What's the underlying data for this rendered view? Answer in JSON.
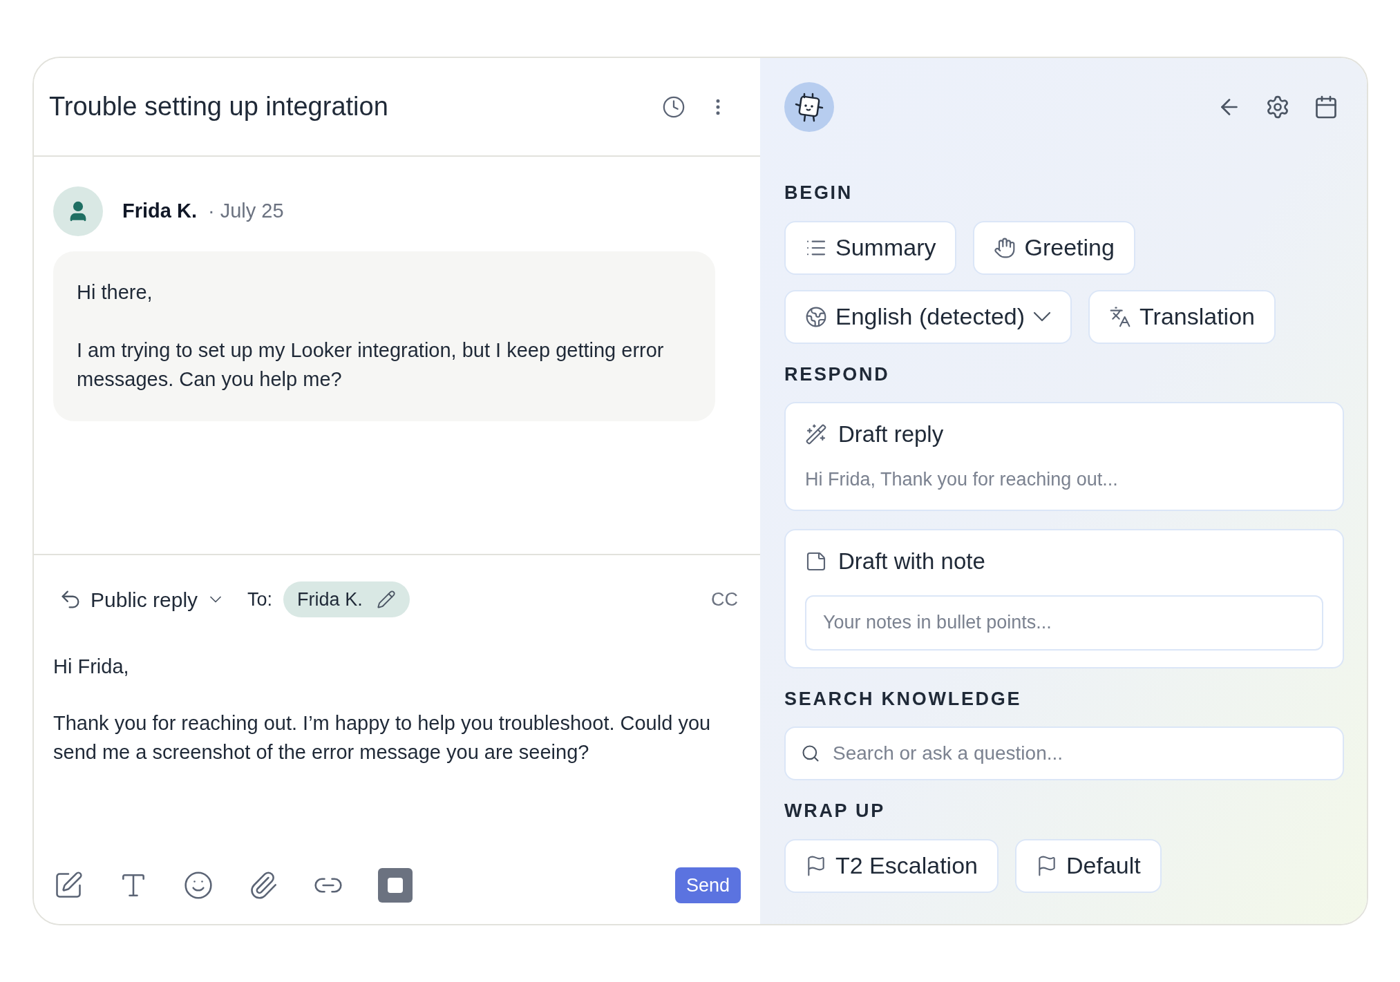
{
  "conversation": {
    "title": "Trouble setting up integration"
  },
  "message": {
    "author": "Frida K.",
    "date": "· July 25",
    "paragraphs": [
      "Hi there,",
      "I am trying to set up my Looker integration, but I keep getting error messages. Can you help me?"
    ]
  },
  "reply": {
    "mode": "Public reply",
    "to_label": "To:",
    "recipient": "Frida K.",
    "cc": "CC",
    "paragraphs": [
      "Hi Frida,",
      "Thank you for reaching out. I’m happy to help you troubleshoot. Could you send me a screenshot of the error message you are seeing?"
    ],
    "send": "Send"
  },
  "assistant": {
    "sections": [
      {
        "kind": "buttons",
        "heading": "BEGIN",
        "items": [
          {
            "label": "Summary",
            "kind": "button"
          },
          {
            "label": "Greeting",
            "kind": "button"
          },
          {
            "label": "English (detected)",
            "kind": "dropdown"
          },
          {
            "label": "Translation",
            "kind": "button"
          }
        ]
      },
      {
        "kind": "cards",
        "heading": "RESPOND",
        "items": [
          {
            "label": "Draft reply",
            "kind": "preview",
            "text": "Hi Frida, Thank you for reaching out..."
          },
          {
            "label": "Draft with note",
            "kind": "input",
            "placeholder": "Your notes in bullet points..."
          }
        ]
      },
      {
        "kind": "search",
        "heading": "SEARCH KNOWLEDGE",
        "placeholder": "Search or ask a question..."
      },
      {
        "kind": "buttons",
        "heading": "WRAP UP",
        "items": [
          {
            "label": "T2 Escalation",
            "kind": "button"
          },
          {
            "label": "Default",
            "kind": "button"
          }
        ]
      }
    ]
  }
}
